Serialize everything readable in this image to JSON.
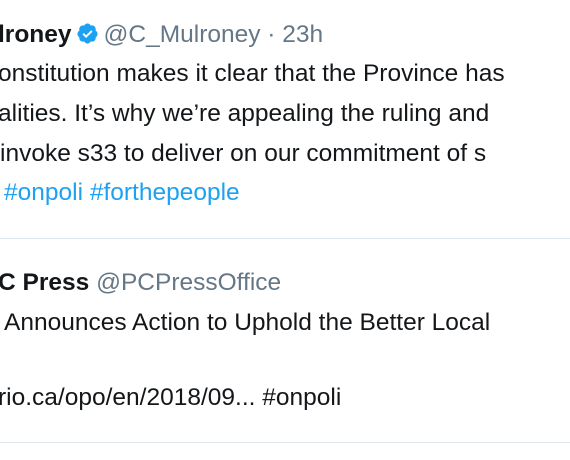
{
  "tweet1": {
    "name_fragment": "lroney",
    "handle": "@C_Mulroney",
    "separator": "·",
    "time": "23h",
    "text_lines": [
      "onstitution makes it clear that the Province has",
      "alities. It’s why we’re appealing the ruling and",
      "invoke s33 to deliver on our commitment of s"
    ],
    "hashtags": [
      "#onpoli",
      "#forthepeople"
    ]
  },
  "tweet2": {
    "name_fragment": "C Press",
    "handle": "@PCPressOffice",
    "text_line": "Announces Action to Uphold the Better Local",
    "link_fragment": "rio.ca/opo/en/2018/09...",
    "hashtag": "#onpoli"
  },
  "icons": {
    "verified": "verified-badge-icon"
  },
  "colors": {
    "text": "#14171a",
    "secondary": "#657786",
    "accent": "#1da1f2",
    "divider": "#e1e8ed"
  }
}
